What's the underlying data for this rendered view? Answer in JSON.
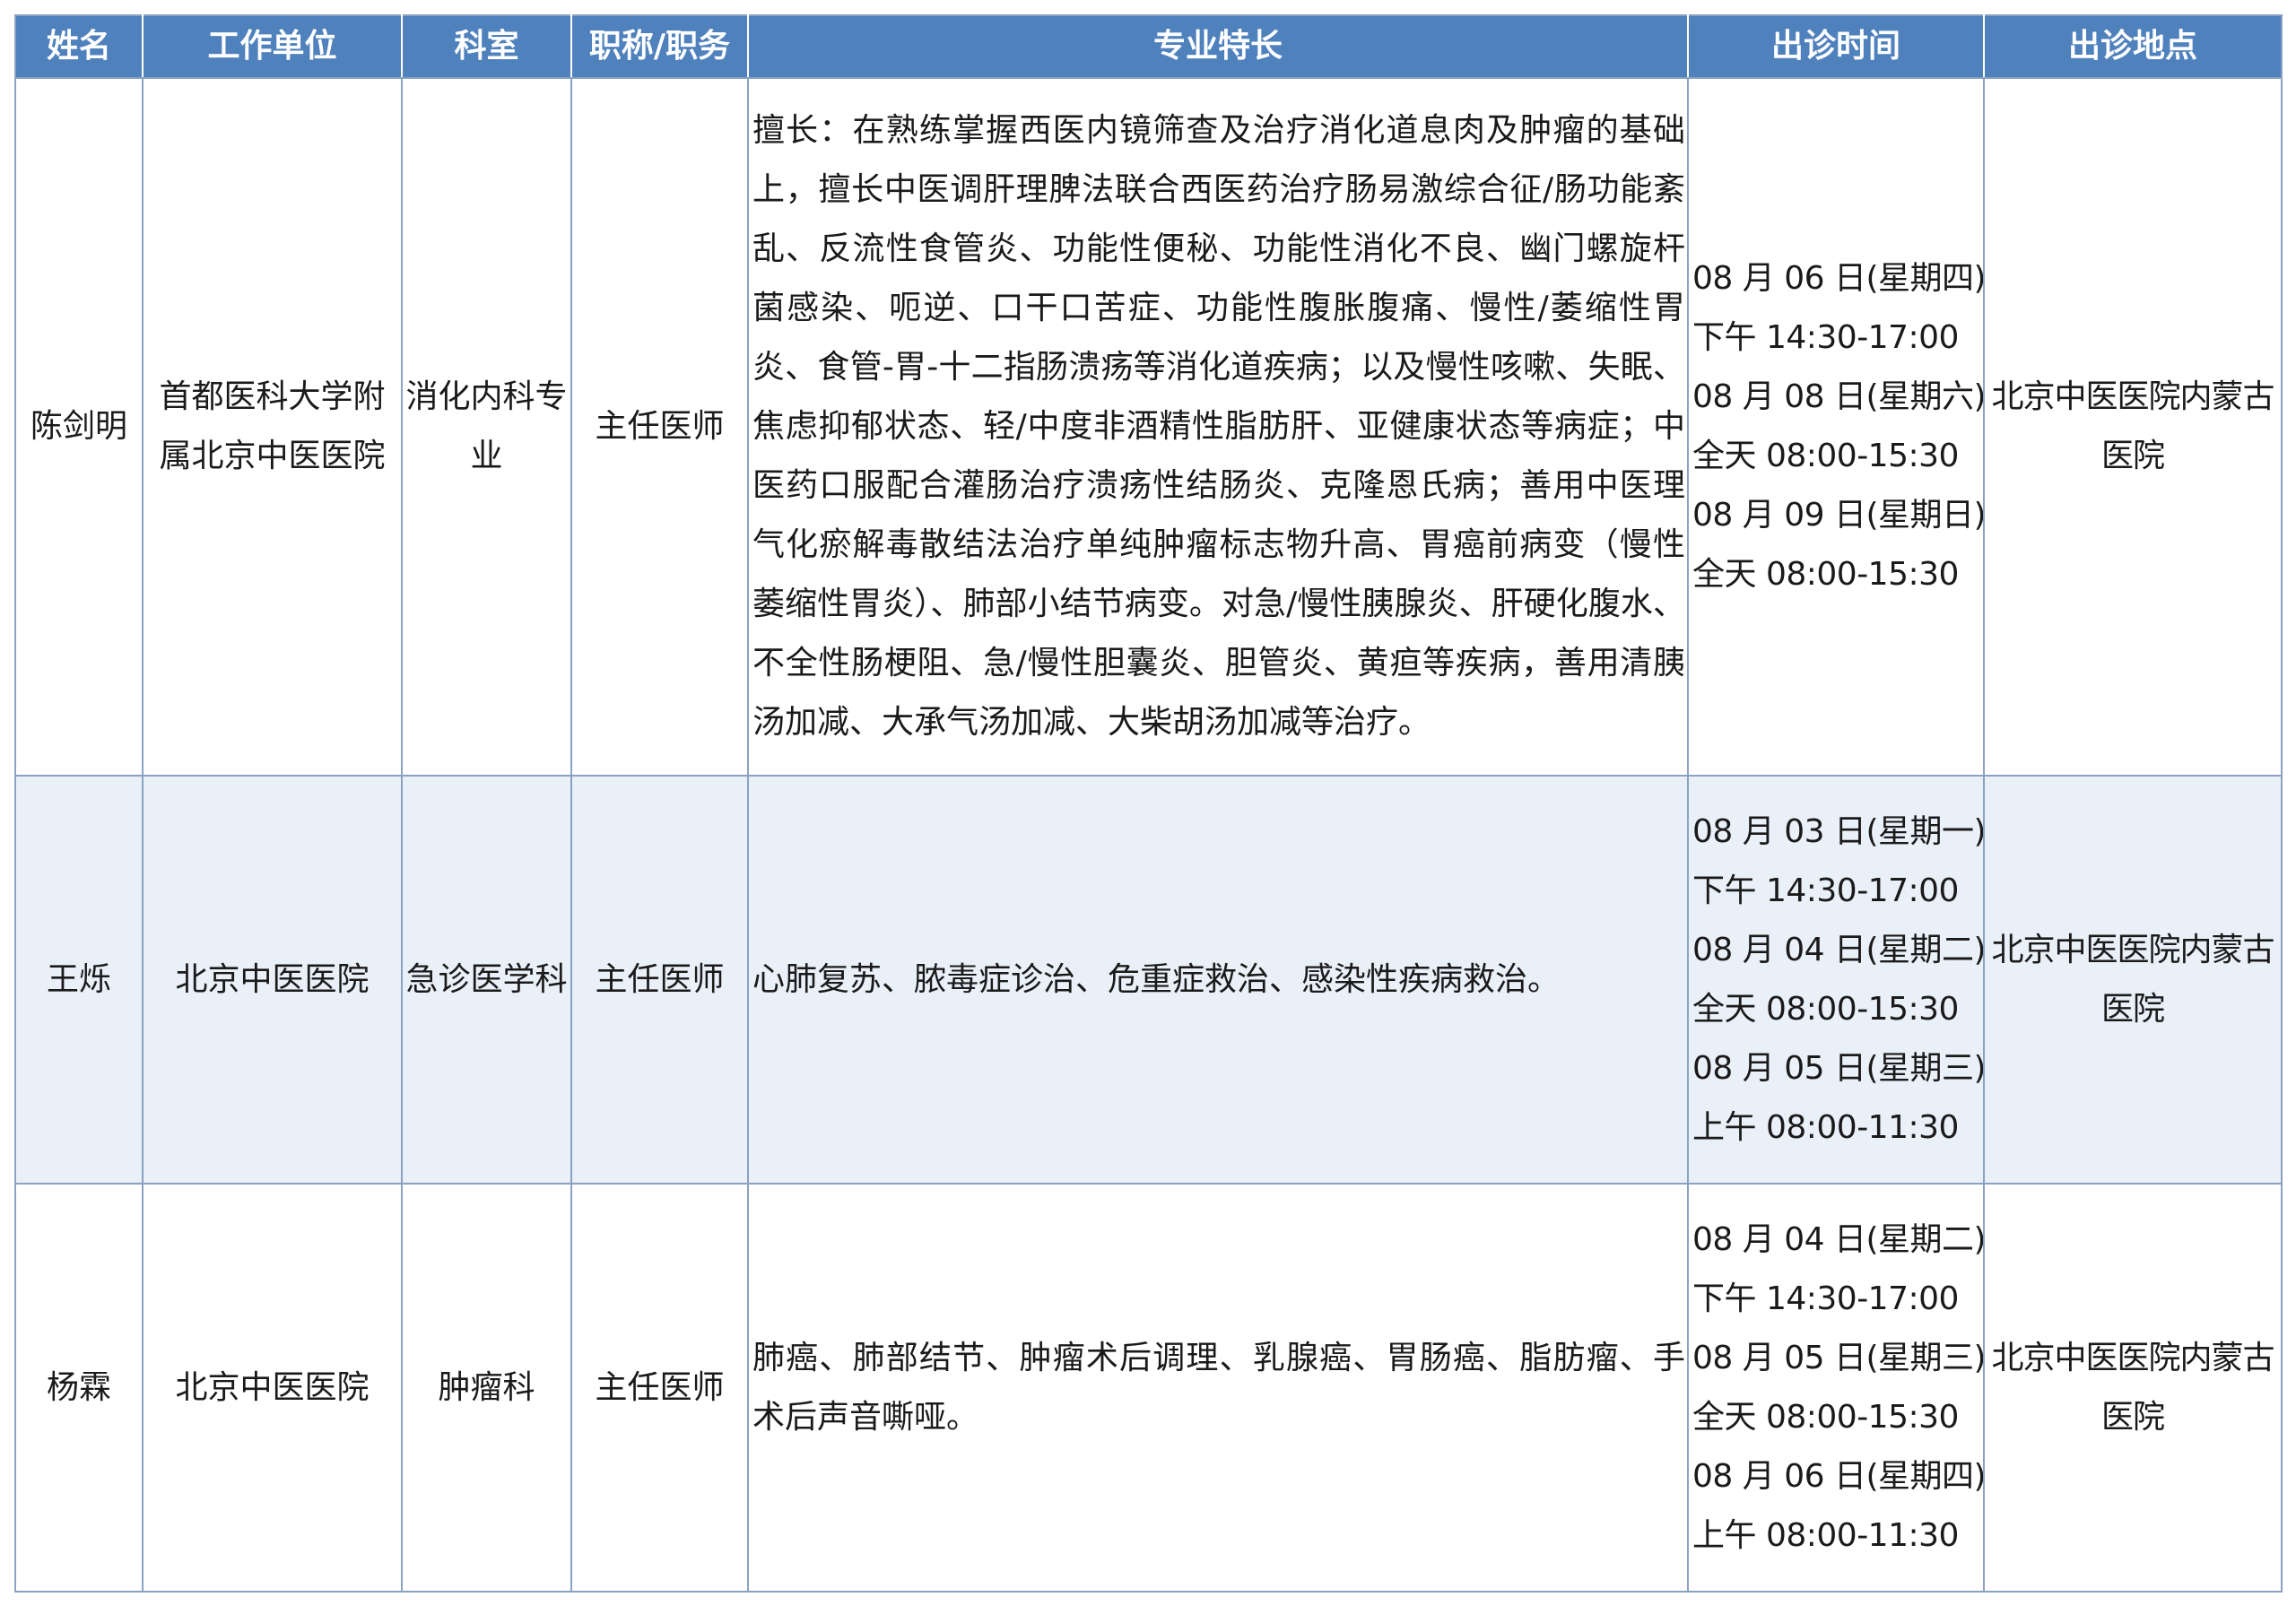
{
  "table": {
    "headers": [
      "姓名",
      "工作单位",
      "科室",
      "职称/职务",
      "专业特长",
      "出诊时间",
      "出诊地点"
    ],
    "rows": [
      {
        "name": "陈剑明",
        "unit": "首都医科大学附属北京中医医院",
        "department": "消化内科专业",
        "title": "主任医师",
        "specialty": "擅长：在熟练掌握西医内镜筛查及治疗消化道息肉及肿瘤的基础上，擅长中医调肝理脾法联合西医药治疗肠易激综合征/肠功能紊乱、反流性食管炎、功能性便秘、功能性消化不良、幽门螺旋杆菌感染、呃逆、口干口苦症、功能性腹胀腹痛、慢性/萎缩性胃炎、食管-胃-十二指肠溃疡等消化道疾病；以及慢性咳嗽、失眠、焦虑抑郁状态、轻/中度非酒精性脂肪肝、亚健康状态等病症；中医药口服配合灌肠治疗溃疡性结肠炎、克隆恩氏病；善用中医理气化瘀解毒散结法治疗单纯肿瘤标志物升高、胃癌前病变（慢性萎缩性胃炎）、肺部小结节病变。对急/慢性胰腺炎、肝硬化腹水、不全性肠梗阻、急/慢性胆囊炎、胆管炎、黄疸等疾病，善用清胰汤加减、大承气汤加减、大柴胡汤加减等治疗。",
        "schedule": [
          "08 月 06 日(星期四)",
          "下午 14:30-17:00",
          "08 月 08 日(星期六)",
          "全天 08:00-15:30",
          "08 月 09 日(星期日)",
          "全天 08:00-15:30"
        ],
        "location": "北京中医医院内蒙古医院"
      },
      {
        "name": "王烁",
        "unit": "北京中医医院",
        "department": "急诊医学科",
        "title": "主任医师",
        "specialty": "心肺复苏、脓毒症诊治、危重症救治、感染性疾病救治。",
        "schedule": [
          "08 月 03 日(星期一)",
          "下午 14:30-17:00",
          "08 月 04 日(星期二)",
          "全天 08:00-15:30",
          "08 月 05 日(星期三)",
          "上午 08:00-11:30"
        ],
        "location": "北京中医医院内蒙古医院"
      },
      {
        "name": "杨霖",
        "unit": "北京中医医院",
        "department": "肿瘤科",
        "title": "主任医师",
        "specialty": "肺癌、肺部结节、肿瘤术后调理、乳腺癌、胃肠癌、脂肪瘤、手术后声音嘶哑。",
        "schedule": [
          "08 月 04 日(星期二)",
          "下午 14:30-17:00",
          "08 月 05 日(星期三)",
          "全天 08:00-15:30",
          "08 月 06 日(星期四)",
          "上午 08:00-11:30"
        ],
        "location": "北京中医医院内蒙古医院"
      }
    ]
  }
}
